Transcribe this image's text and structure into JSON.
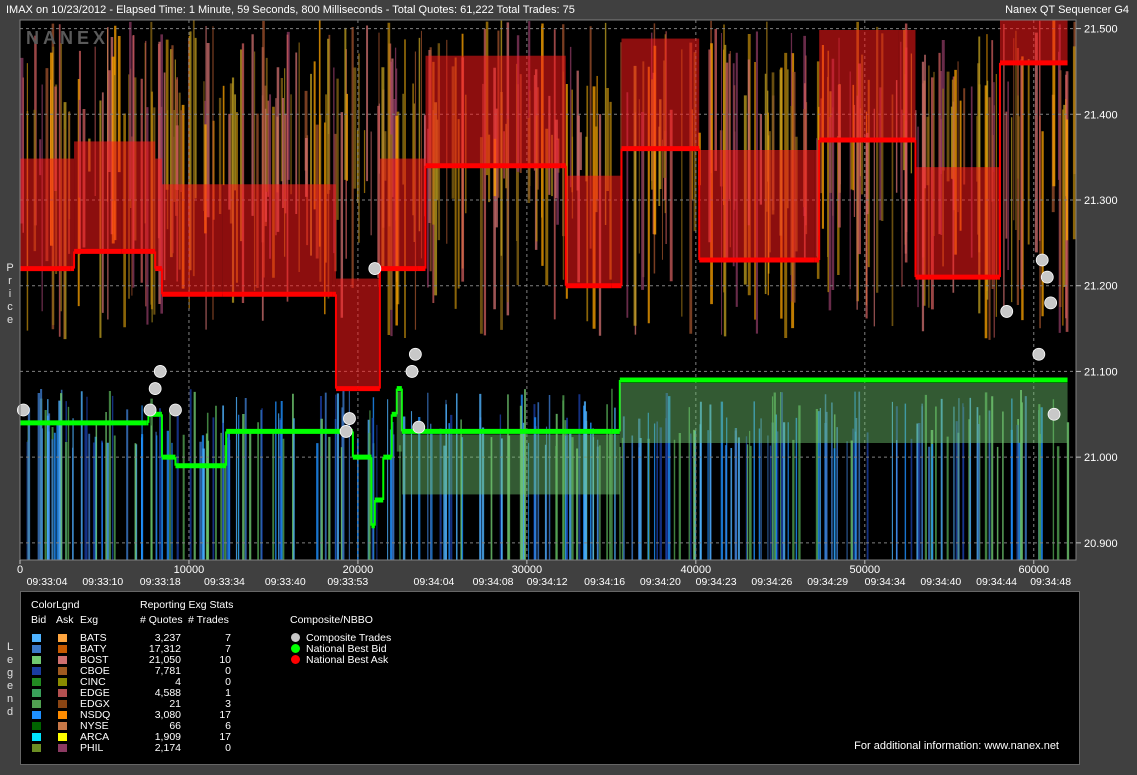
{
  "header": {
    "title": "IMAX on 10/23/2012  -  Elapsed Time: 1 Minute, 59 Seconds, 800 Milliseconds  -  Total Quotes: 61,222  Total Trades: 75",
    "app_name": "Nanex QT Sequencer G4",
    "watermark": "NANEX"
  },
  "side_labels": {
    "price": "Price",
    "legend": "Legend"
  },
  "colors": {
    "background": "#404040",
    "plot_bg": "#000000",
    "bid": "#00ff00",
    "ask": "#ff0000",
    "trade": "#c8c8c8"
  },
  "chart_data": {
    "type": "scatter",
    "title": "",
    "xlabel": "",
    "ylabel": "Price",
    "xlim": [
      0,
      62500
    ],
    "ylim": [
      20.88,
      21.51
    ],
    "x_ticks": [
      0,
      10000,
      20000,
      30000,
      40000,
      50000,
      60000
    ],
    "y_ticks": [
      20.9,
      21.0,
      21.1,
      21.2,
      21.3,
      21.4,
      21.5
    ],
    "y_tick_labels": [
      "20.900",
      "21.000",
      "21.100",
      "21.200",
      "21.300",
      "21.400",
      "21.500"
    ],
    "time_labels": [
      "09:33:04",
      "09:33:10",
      "09:33:18",
      "09:33:34",
      "09:33:40",
      "09:33:53",
      "09:34:04",
      "09:34:08",
      "09:34:12",
      "09:34:16",
      "09:34:20",
      "09:34:23",
      "09:34:26",
      "09:34:29",
      "09:34:34",
      "09:34:40",
      "09:34:44",
      "09:34:48"
    ],
    "time_label_x": [
      1600,
      4900,
      8300,
      12100,
      15700,
      19400,
      24500,
      28000,
      31200,
      34600,
      37900,
      41200,
      44500,
      47800,
      51200,
      54500,
      57800,
      61000
    ],
    "grid": true,
    "series": [
      {
        "name": "National Best Bid",
        "x": [
          0,
          7500,
          7600,
          8300,
          8400,
          9000,
          9200,
          12000,
          12200,
          19500,
          19700,
          20800,
          21000,
          21500,
          22000,
          22300,
          22600,
          35000,
          35500,
          62000
        ],
        "y": [
          21.04,
          21.04,
          21.05,
          21.05,
          21.0,
          21.0,
          20.99,
          20.99,
          21.03,
          21.03,
          21.0,
          20.92,
          20.95,
          21.0,
          21.05,
          21.08,
          21.03,
          21.03,
          21.09,
          21.09
        ]
      },
      {
        "name": "National Best Ask",
        "x": [
          0,
          3000,
          3200,
          6000,
          8000,
          8400,
          12000,
          18500,
          18700,
          20000,
          21300,
          23500,
          24000,
          32000,
          32300,
          35000,
          35600,
          40000,
          40200,
          47000,
          47300,
          52000,
          53000,
          57500,
          58000,
          62000
        ],
        "y": [
          21.22,
          21.22,
          21.24,
          21.24,
          21.22,
          21.19,
          21.19,
          21.19,
          21.08,
          21.08,
          21.22,
          21.22,
          21.34,
          21.34,
          21.2,
          21.2,
          21.36,
          21.36,
          21.23,
          21.23,
          21.37,
          21.37,
          21.21,
          21.21,
          21.46,
          21.46
        ]
      },
      {
        "name": "Composite Trades",
        "x": [
          200,
          7700,
          8000,
          8300,
          9200,
          19300,
          19500,
          21000,
          23200,
          23400,
          23600,
          58400,
          60300,
          60500,
          60800,
          61000,
          61200
        ],
        "y": [
          21.055,
          21.055,
          21.08,
          21.1,
          21.055,
          21.03,
          21.045,
          21.22,
          21.1,
          21.12,
          21.035,
          21.17,
          21.12,
          21.23,
          21.21,
          21.18,
          21.05
        ]
      }
    ]
  },
  "legend": {
    "colorlgnd_label": "ColorLgnd",
    "bid_header": "Bid",
    "ask_header": "Ask",
    "exg_header": "Exg",
    "stats_label": "Reporting Exg Stats",
    "quotes_header": "# Quotes",
    "trades_header": "# Trades",
    "composite_label": "Composite/NBBO",
    "composite_items": [
      {
        "label": "Composite Trades",
        "color": "#c8c8c8"
      },
      {
        "label": "National Best Bid",
        "color": "#00ff00"
      },
      {
        "label": "National Best Ask",
        "color": "#ff0000"
      }
    ],
    "rows": [
      {
        "exg": "BATS",
        "quotes": "3,237",
        "trades": "7",
        "bid_color": "#4fb3ff",
        "ask_color": "#ffa640"
      },
      {
        "exg": "BATY",
        "quotes": "17,312",
        "trades": "7",
        "bid_color": "#3b78c8",
        "ask_color": "#c85a00"
      },
      {
        "exg": "BOST",
        "quotes": "21,050",
        "trades": "10",
        "bid_color": "#70c870",
        "ask_color": "#d07070"
      },
      {
        "exg": "CBOE",
        "quotes": "7,781",
        "trades": "0",
        "bid_color": "#1a3ca0",
        "ask_color": "#a05a20"
      },
      {
        "exg": "CINC",
        "quotes": "4",
        "trades": "0",
        "bid_color": "#228b22",
        "ask_color": "#8b8b00"
      },
      {
        "exg": "EDGE",
        "quotes": "4,588",
        "trades": "1",
        "bid_color": "#3aa05a",
        "ask_color": "#b45050"
      },
      {
        "exg": "EDGX",
        "quotes": "21",
        "trades": "3",
        "bid_color": "#50a050",
        "ask_color": "#8b4513"
      },
      {
        "exg": "NSDQ",
        "quotes": "3,080",
        "trades": "17",
        "bid_color": "#1e90ff",
        "ask_color": "#ff8c00"
      },
      {
        "exg": "NYSE",
        "quotes": "66",
        "trades": "6",
        "bid_color": "#006400",
        "ask_color": "#c87848"
      },
      {
        "exg": "ARCA",
        "quotes": "1,909",
        "trades": "17",
        "bid_color": "#00e5ff",
        "ask_color": "#ffff00"
      },
      {
        "exg": "PHIL",
        "quotes": "2,174",
        "trades": "0",
        "bid_color": "#6b8e23",
        "ask_color": "#8b3a62"
      }
    ]
  },
  "footer": {
    "info": "For additional information: www.nanex.net"
  }
}
